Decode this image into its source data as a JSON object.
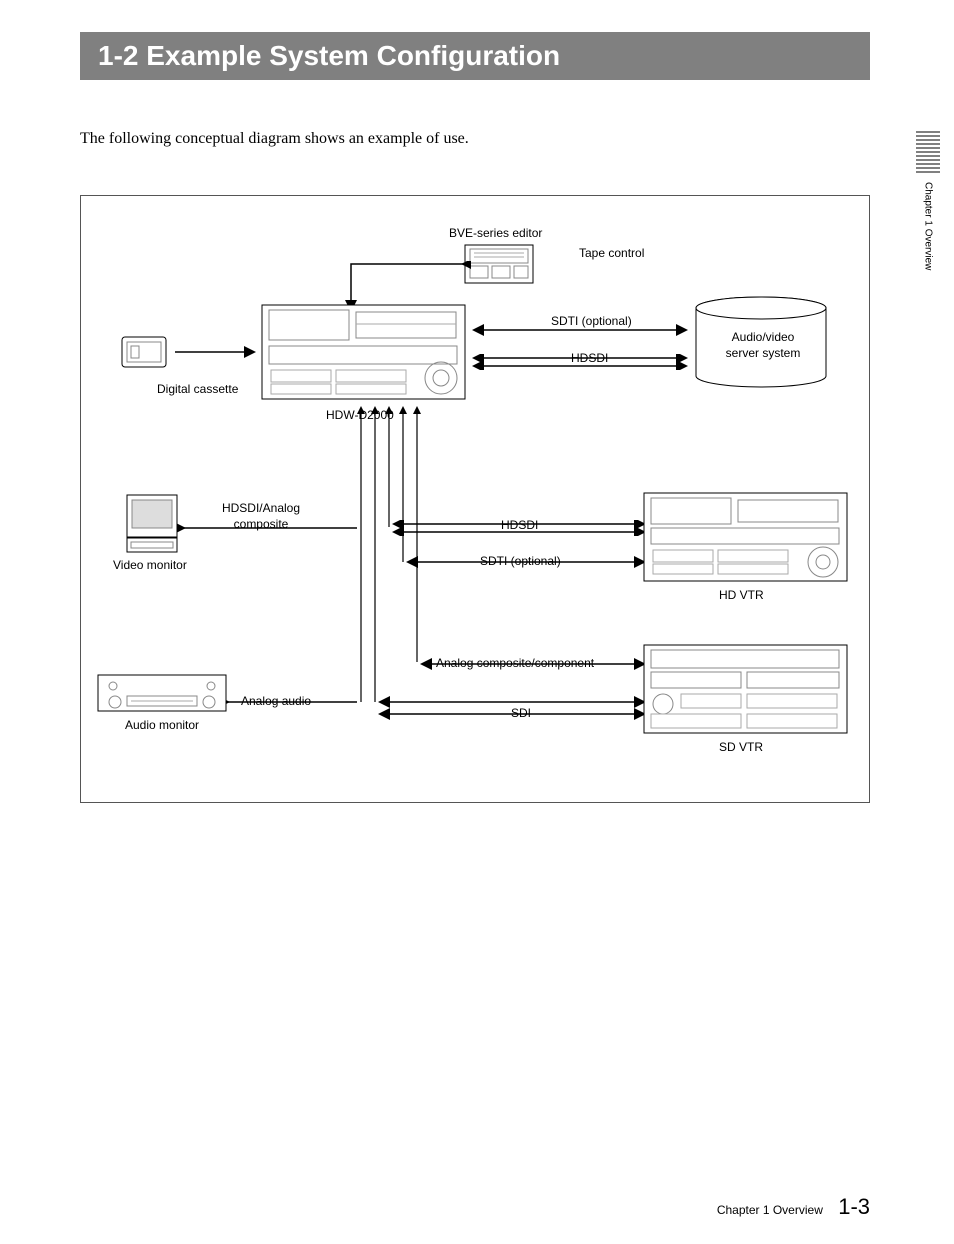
{
  "header": {
    "section_title": "1-2  Example System Configuration"
  },
  "intro": "The following conceptual diagram shows an example of use.",
  "side_tab": {
    "text": "Chapter 1   Overview"
  },
  "diagram": {
    "labels": {
      "bve_editor": "BVE-series editor",
      "tape_control": "Tape control",
      "sdti_optional_top": "SDTI (optional)",
      "hdsdi_top": "HDSDI",
      "audio_video_server": "Audio/video server system",
      "digital_cassette": "Digital cassette",
      "hdw_d2000": "HDW-D2000",
      "hdsdi_analog_composite": "HDSDI/Analog composite",
      "video_monitor": "Video monitor",
      "hdsdi_mid": "HDSDI",
      "sdti_optional_mid": "SDTI (optional)",
      "hd_vtr": "HD VTR",
      "analog_composite_component": "Analog composite/component",
      "analog_audio": "Analog audio",
      "sdi": "SDI",
      "sd_vtr": "SD VTR",
      "audio_monitor": "Audio monitor"
    }
  },
  "footer": {
    "chapter": "Chapter 1   Overview",
    "page": "1-3"
  }
}
